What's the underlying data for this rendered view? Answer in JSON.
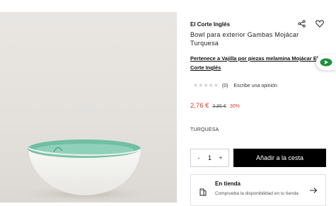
{
  "product": {
    "brand": "El Corte Inglés",
    "title": "Bowl para exterior Gambas Mojácar Turquesa",
    "collection_link": "Pertenece a Vajilla por piezas melamina Mojácar El Corte Inglés",
    "rating_stars": 0,
    "rating_max": 5,
    "rating_count": "(0)",
    "review_link": "Escribe una opinión",
    "price_current": "2,76 €",
    "price_old": "3,95 €",
    "price_discount": "30%",
    "color_name": "TURQUESA"
  },
  "actions": {
    "share_icon": "share-icon",
    "favorite_icon": "heart-icon",
    "quantity": "1",
    "minus": "-",
    "plus": "+",
    "add_to_cart": "Añadir a la cesta"
  },
  "store": {
    "title": "En tienda",
    "description": "Comprueba la disponibilidad en tu tienda",
    "icon": "store-icon"
  },
  "colors": {
    "price_red": "#e0382d",
    "button_black": "#000000",
    "bowl_turquoise": "#6fbfa5",
    "side_tab_green": "#1e8e3e"
  }
}
